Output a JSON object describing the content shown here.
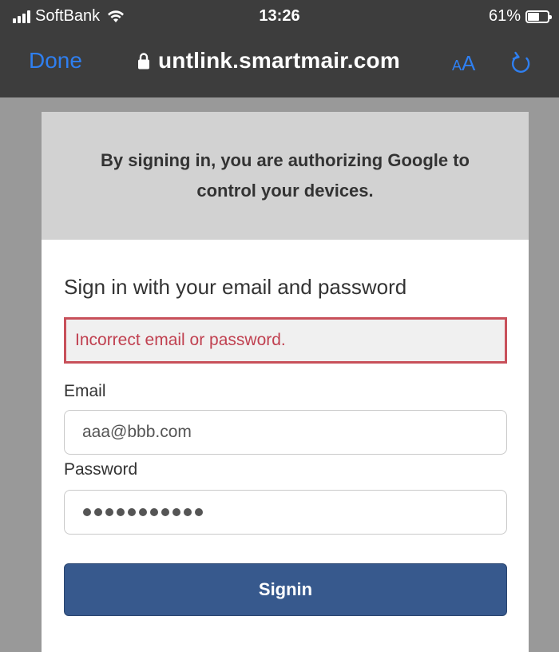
{
  "status_bar": {
    "carrier": "SoftBank",
    "time": "13:26",
    "battery_percent": "61%",
    "battery_level": 0.61
  },
  "browser": {
    "done_label": "Done",
    "url": "untlink.smartmair.com",
    "text_size_label_small": "A",
    "text_size_label_big": "A",
    "accent_color": "#2f7ff0"
  },
  "card": {
    "banner_text": "By signing in, you are authorizing Google to control your devices.",
    "heading": "Sign in with your email and password",
    "error_message": "Incorrect email or password.",
    "email_label": "Email",
    "email_value": "aaa@bbb.com",
    "password_label": "Password",
    "password_mask_length": 11,
    "signin_button": "Signin",
    "button_color": "#37598d",
    "error_color": "#c8505a"
  }
}
